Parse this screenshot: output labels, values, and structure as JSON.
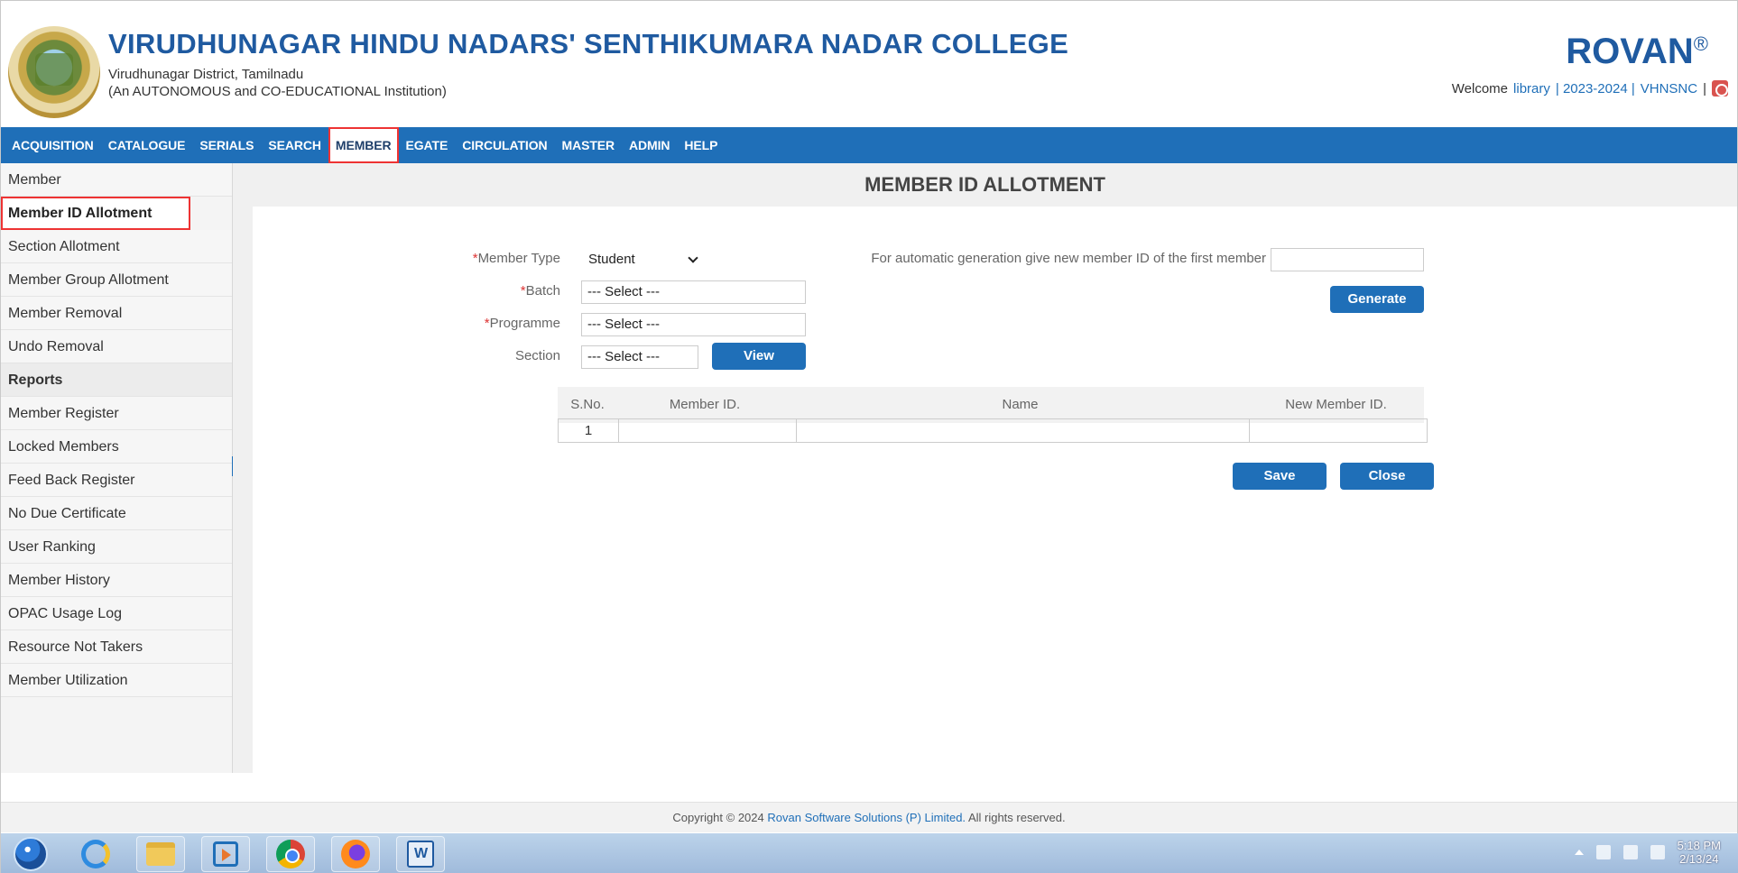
{
  "header": {
    "college_name": "VIRUDHUNAGAR HINDU NADARS' SENTHIKUMARA NADAR COLLEGE",
    "location": "Virudhunagar District, Tamilnadu",
    "institution_type": "(An AUTONOMOUS and CO-EDUCATIONAL Institution)",
    "brand": "ROVAN",
    "brand_mark": "®",
    "welcome_label": "Welcome",
    "user": "library",
    "academic_year": "| 2023-2024 |",
    "institution_code": "VHNSNC",
    "separator": "|"
  },
  "nav": {
    "items": [
      {
        "label": "ACQUISITION",
        "active": false
      },
      {
        "label": "CATALOGUE",
        "active": false
      },
      {
        "label": "SERIALS",
        "active": false
      },
      {
        "label": "SEARCH",
        "active": false
      },
      {
        "label": "MEMBER",
        "active": true
      },
      {
        "label": "EGATE",
        "active": false
      },
      {
        "label": "CIRCULATION",
        "active": false
      },
      {
        "label": "MASTER",
        "active": false
      },
      {
        "label": "ADMIN",
        "active": false
      },
      {
        "label": "HELP",
        "active": false
      }
    ]
  },
  "sidebar": {
    "items": [
      {
        "label": "Member"
      },
      {
        "label": "Member ID Allotment"
      },
      {
        "label": "Section Allotment"
      },
      {
        "label": "Member Group Allotment"
      },
      {
        "label": "Member Removal"
      },
      {
        "label": "Undo Removal"
      },
      {
        "label": "Reports"
      },
      {
        "label": "Member Register"
      },
      {
        "label": "Locked Members"
      },
      {
        "label": "Feed Back Register"
      },
      {
        "label": "No Due Certificate"
      },
      {
        "label": "User Ranking"
      },
      {
        "label": "Member History"
      },
      {
        "label": "OPAC Usage Log"
      },
      {
        "label": "Resource Not Takers"
      },
      {
        "label": "Member Utilization"
      }
    ]
  },
  "main": {
    "title": "MEMBER ID ALLOTMENT",
    "required_mark": "*",
    "member_type_label": "Member Type",
    "member_type_value": "Student",
    "batch_label": "Batch",
    "batch_value": "--- Select ---",
    "programme_label": "Programme",
    "programme_value": "--- Select ---",
    "section_label": "Section",
    "section_value": "--- Select ---",
    "view_button": "View",
    "auto_gen_label": "For automatic generation give new member ID of the first member",
    "auto_gen_value": "",
    "generate_button": "Generate",
    "table": {
      "headers": [
        "S.No.",
        "Member ID.",
        "Name",
        "New Member ID."
      ],
      "rows": [
        {
          "sno": "1",
          "member_id": "",
          "name": "",
          "new_member_id": ""
        }
      ]
    },
    "save_button": "Save",
    "close_button": "Close"
  },
  "footer": {
    "prefix": "Copyright © 2024",
    "company": "Rovan Software Solutions (P) Limited.",
    "suffix": "All rights reserved."
  },
  "taskbar": {
    "time": "5:18 PM",
    "date": "2/13/24"
  }
}
